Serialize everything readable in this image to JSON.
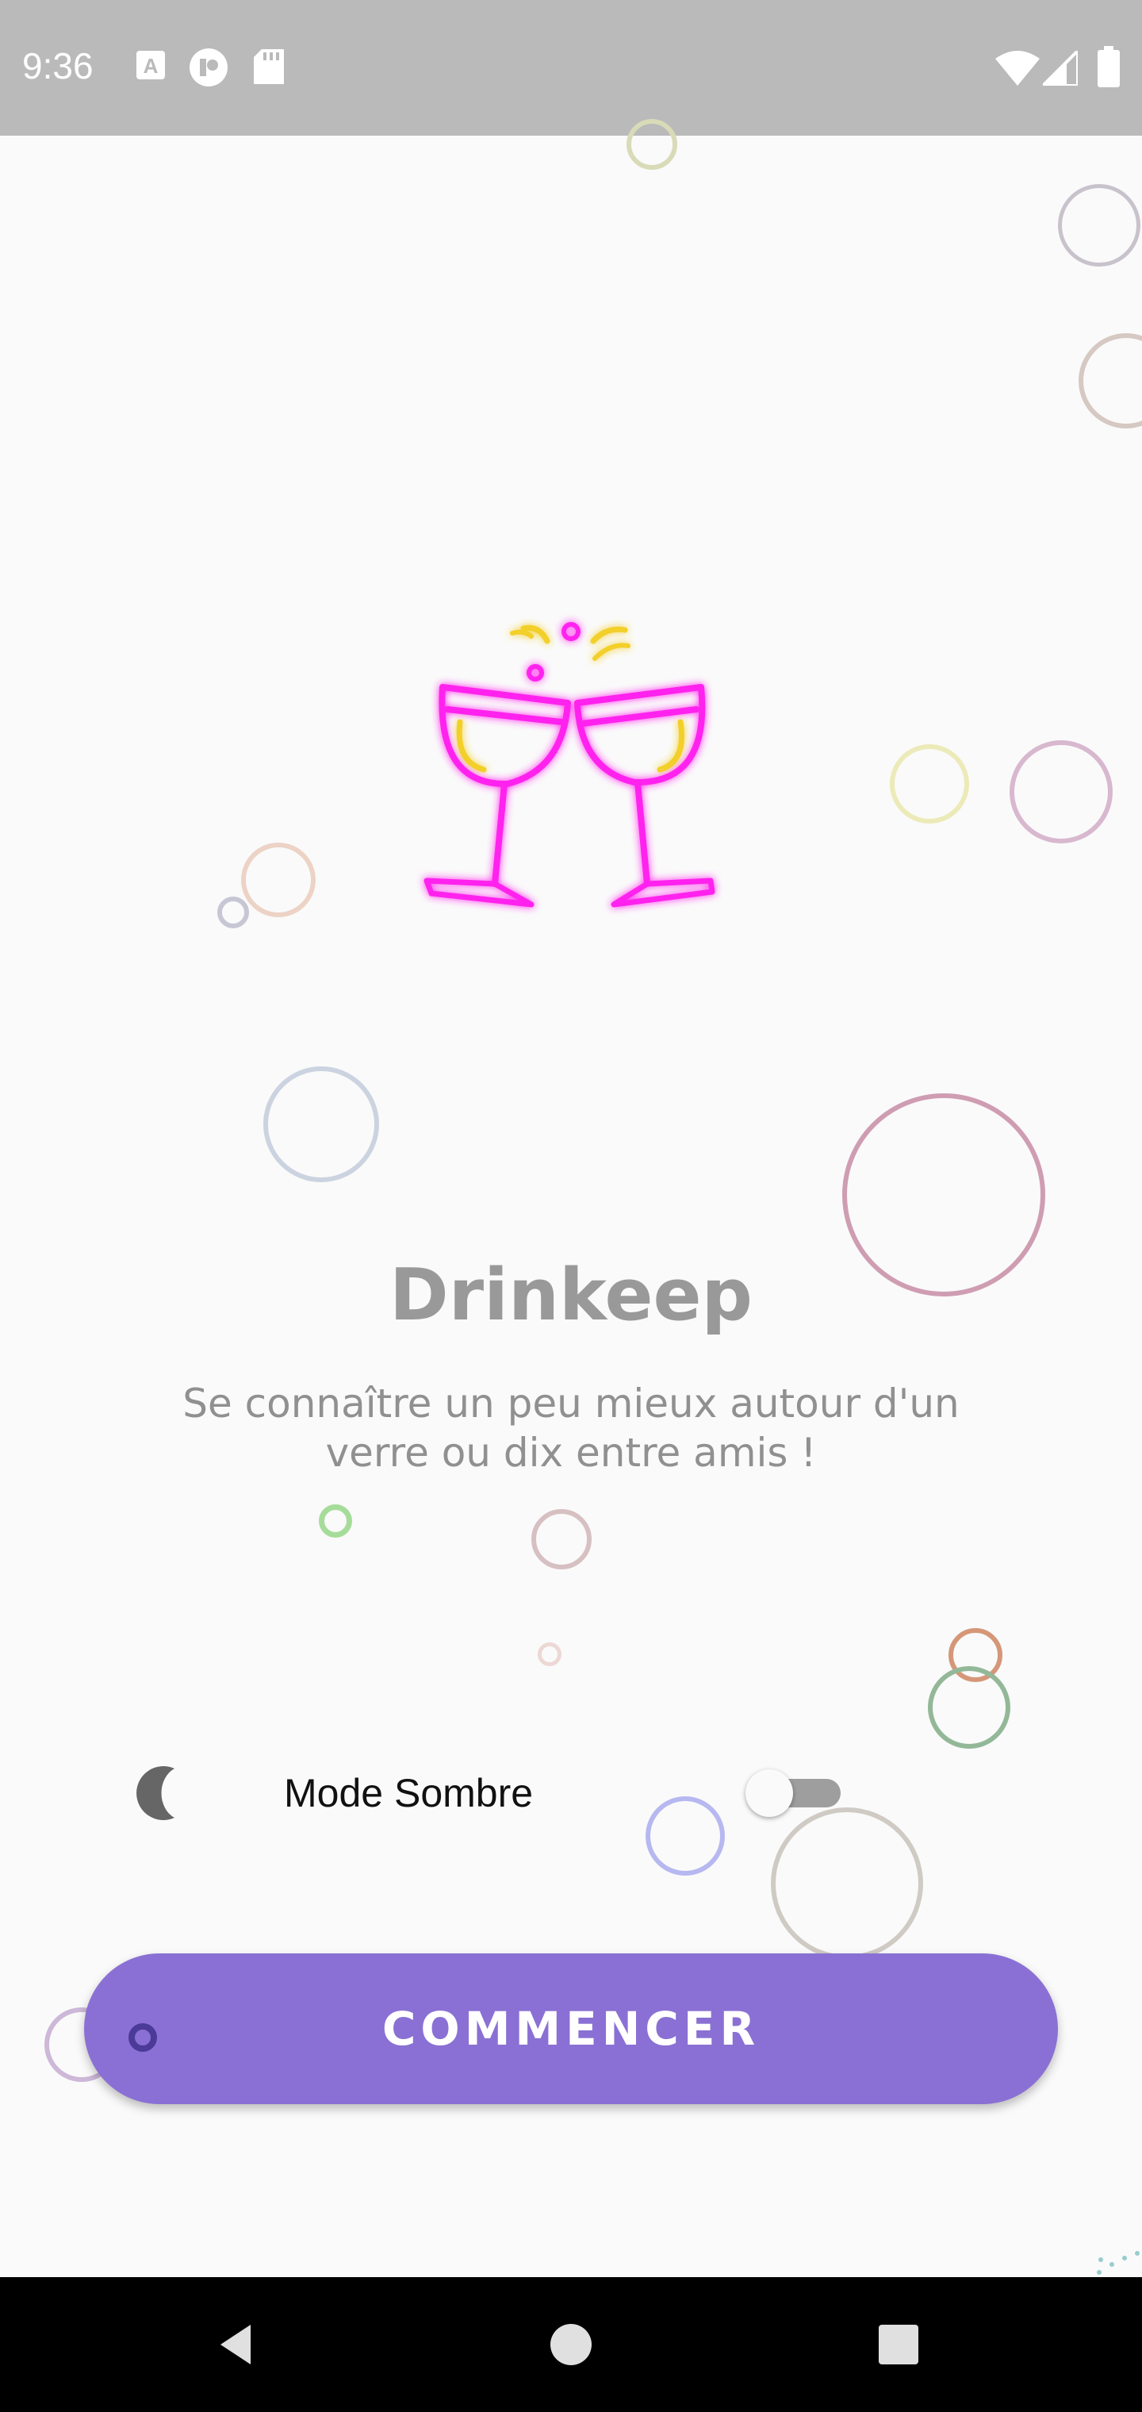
{
  "status_bar": {
    "time": "9:36",
    "left_icons": [
      "a-letter-icon",
      "pocket-casts-icon",
      "sd-card-icon"
    ],
    "right_icons": [
      "wifi-icon",
      "signal-icon",
      "battery-icon"
    ]
  },
  "app": {
    "title": "Drinkeep",
    "tagline_line1": "Se connaître un peu mieux autour d'un",
    "tagline_line2": "verre ou dix entre amis !",
    "logo_icon": "cheers-glasses-icon"
  },
  "settings": {
    "dark_mode_label": "Mode Sombre",
    "dark_mode_enabled": false
  },
  "actions": {
    "start_label": "COMMENCER"
  },
  "colors": {
    "accent": "#8a70d4",
    "logo_neon": "#ff22ee",
    "logo_sparkle": "#f3cf2a",
    "title_gray": "#999999"
  },
  "nav_bar": {
    "buttons": [
      "back-icon",
      "home-icon",
      "recents-icon"
    ]
  }
}
